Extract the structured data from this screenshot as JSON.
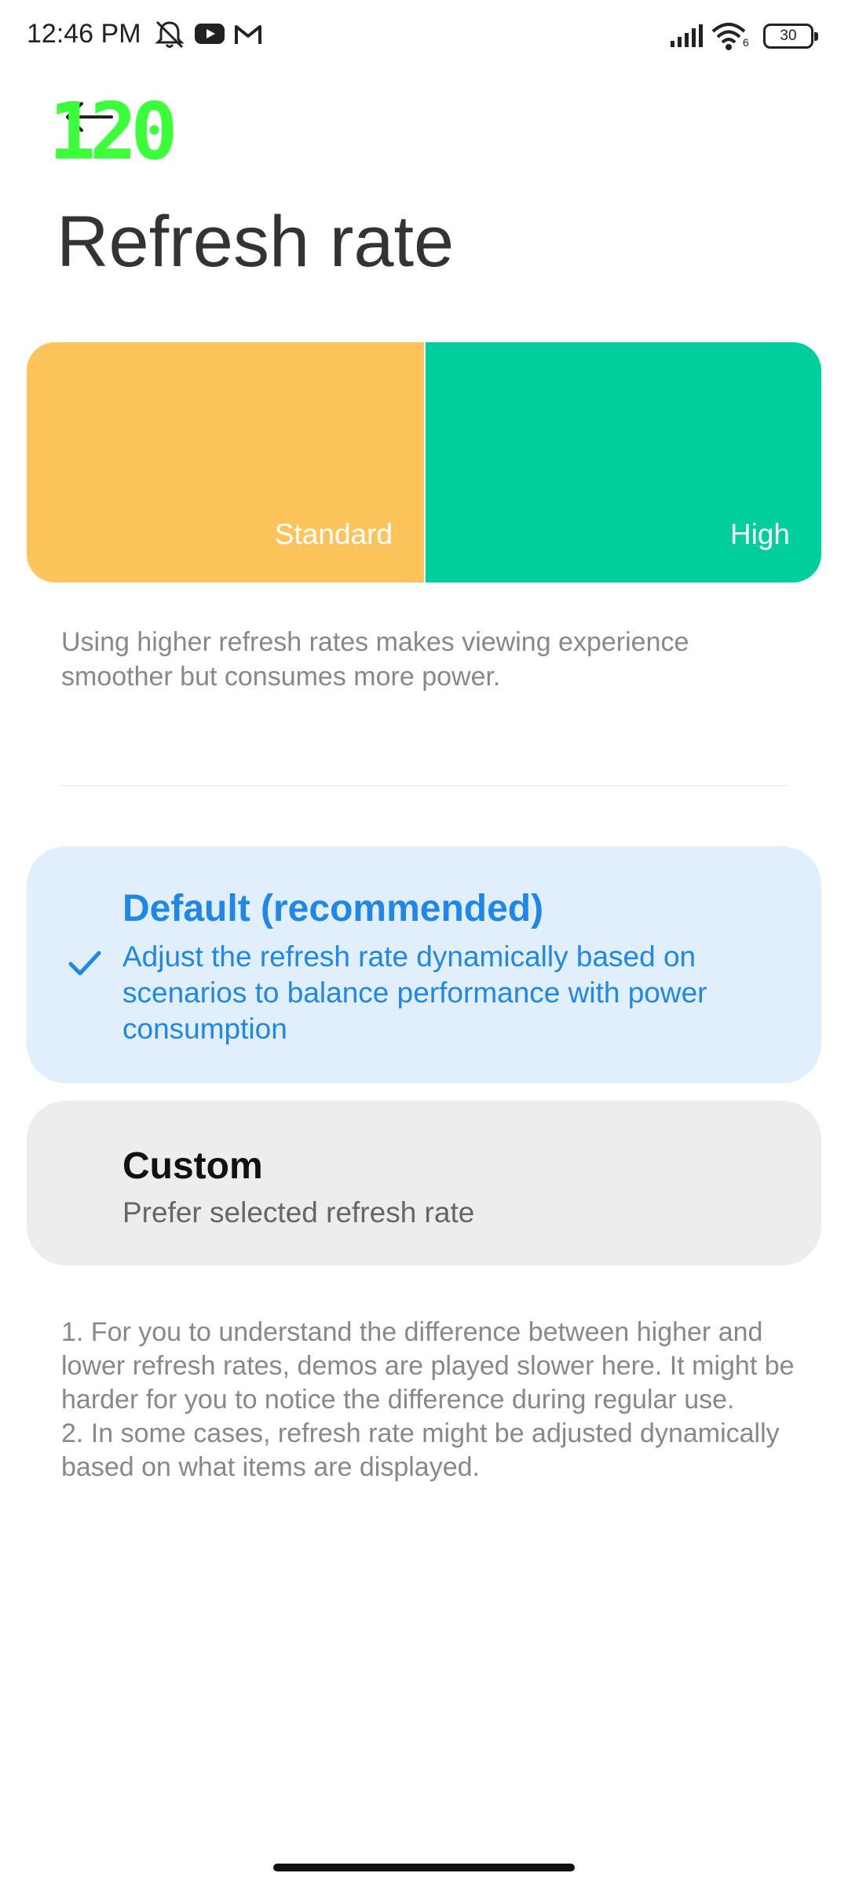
{
  "status_bar": {
    "time": "12:46 PM",
    "battery": "30",
    "icons": [
      "notifications-muted-icon",
      "youtube-icon",
      "gmail-icon",
      "signal-icon",
      "wifi-icon",
      "battery-icon"
    ],
    "wifi_badge": "6"
  },
  "overlay": {
    "fps": "120",
    "color": "#3cff3c"
  },
  "header": {
    "title": "Refresh rate",
    "back_icon": "back-arrow-icon"
  },
  "demo": {
    "standard_label": "Standard",
    "high_label": "High",
    "standard_color": "#fec45c",
    "high_color": "#00ce9c"
  },
  "description": "Using higher refresh rates makes viewing experience smoother but consumes more power.",
  "options": [
    {
      "title": "Default (recommended)",
      "desc": "Adjust the refresh rate dynamically based on scenarios to balance performance with power consumption",
      "selected": true
    },
    {
      "title": "Custom",
      "desc": "Prefer selected refresh rate",
      "selected": false
    }
  ],
  "notes": [
    "1. For you to understand the difference between higher and lower refresh rates, demos are played slower here. It might be harder for you to notice the difference during regular use.",
    "2. In some cases, refresh rate might be adjusted dynamically based on what items are displayed."
  ],
  "colors": {
    "accent": "#1f87e8",
    "selected_bg": "#e1eefc",
    "unselected_bg": "#ededed"
  }
}
